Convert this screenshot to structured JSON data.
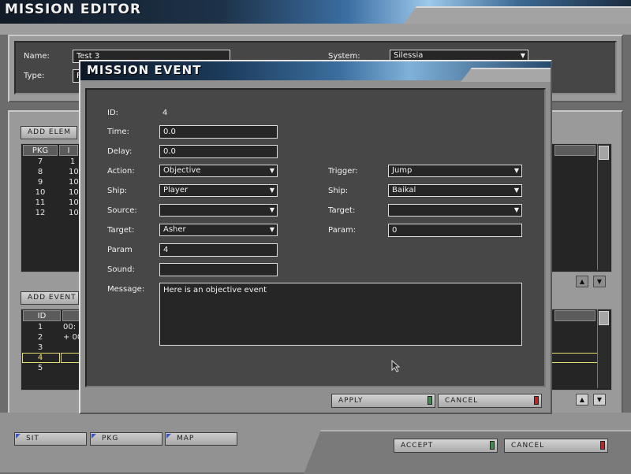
{
  "window": {
    "title": "MISSION EDITOR"
  },
  "mission": {
    "name_label": "Name:",
    "name_value": "Test 3",
    "type_label": "Type:",
    "type_value": "F",
    "system_label": "System:",
    "system_value": "Silessia"
  },
  "elements": {
    "add_button": "ADD ELEM",
    "columns": [
      "PKG",
      "I"
    ],
    "rows": [
      {
        "pkg": "7",
        "id": "1"
      },
      {
        "pkg": "8",
        "id": "10"
      },
      {
        "pkg": "9",
        "id": "10"
      },
      {
        "pkg": "10",
        "id": "10"
      },
      {
        "pkg": "11",
        "id": "10"
      },
      {
        "pkg": "12",
        "id": "10"
      }
    ]
  },
  "events": {
    "add_button": "ADD EVENT",
    "columns": [
      "ID",
      ""
    ],
    "rows": [
      {
        "id": "1",
        "time": "00:"
      },
      {
        "id": "2",
        "time": "+ 00"
      },
      {
        "id": "3",
        "time": ""
      },
      {
        "id": "4",
        "time": ""
      },
      {
        "id": "5",
        "time": ""
      }
    ],
    "selected_id": "4"
  },
  "tabs": [
    "SIT",
    "PKG",
    "MAP"
  ],
  "footer": {
    "accept_label": "ACCEPT",
    "cancel_label": "CANCEL"
  },
  "dialog": {
    "title": "MISSION EVENT",
    "id_label": "ID:",
    "id_value": "4",
    "time_label": "Time:",
    "time_value": "0.0",
    "delay_label": "Delay:",
    "delay_value": "0.0",
    "action_label": "Action:",
    "action_value": "Objective",
    "ship_label": "Ship:",
    "ship_value": "Player",
    "source_label": "Source:",
    "source_value": "",
    "target_label": "Target:",
    "target_value": "Asher",
    "param_label": "Param",
    "param_value": "4",
    "sound_label": "Sound:",
    "sound_value": "",
    "message_label": "Message:",
    "message_value": "Here is an objective event",
    "trigger_label": "Trigger:",
    "trigger_value": "Jump",
    "trigger_ship_label": "Ship:",
    "trigger_ship_value": "Baikal",
    "trigger_target_label": "Target:",
    "trigger_target_value": "",
    "trigger_param_label": "Param:",
    "trigger_param_value": "0",
    "apply_label": "APPLY",
    "cancel_label": "CANCEL"
  },
  "colors": {
    "selection_outline": "#e8e070",
    "led_green": "#3f8a4e",
    "led_red": "#b02a2a",
    "tab_corner": "#3b56c6"
  }
}
